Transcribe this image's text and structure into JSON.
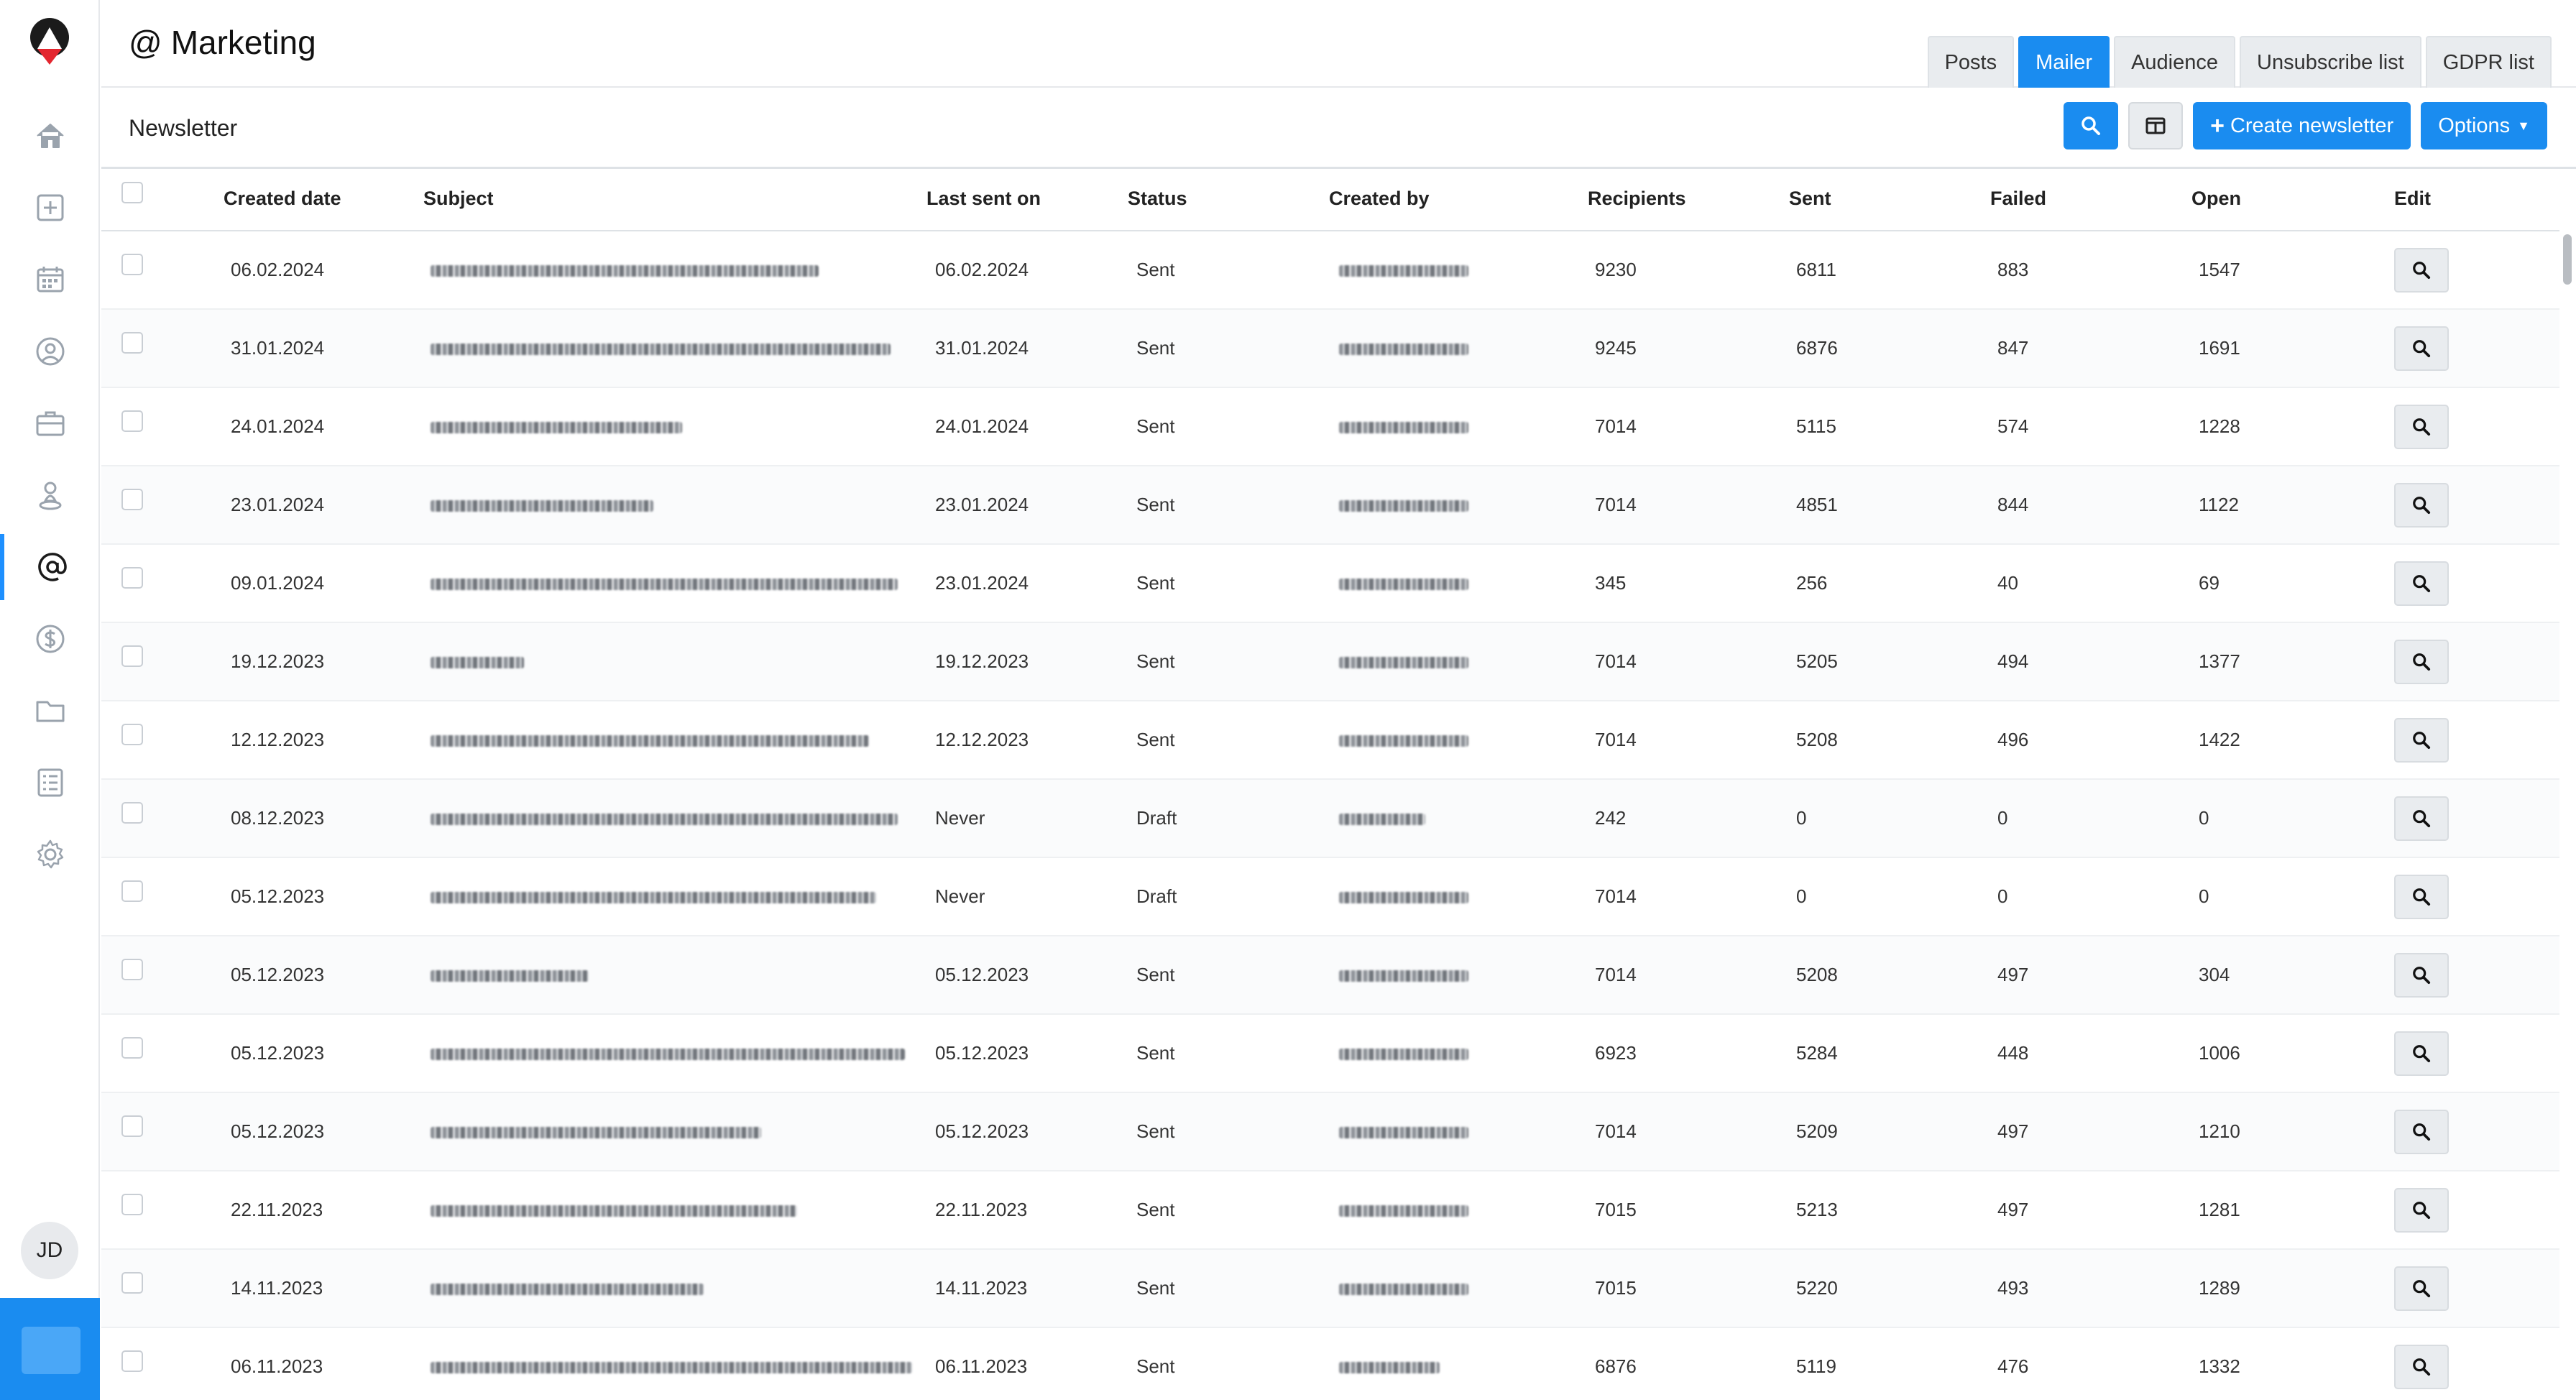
{
  "header": {
    "title_symbol": "@",
    "title": "Marketing",
    "tabs": [
      {
        "label": "Posts",
        "active": false
      },
      {
        "label": "Mailer",
        "active": true
      },
      {
        "label": "Audience",
        "active": false
      },
      {
        "label": "Unsubscribe list",
        "active": false
      },
      {
        "label": "GDPR list",
        "active": false
      }
    ]
  },
  "subheader": {
    "title": "Newsletter",
    "create_label": "Create newsletter",
    "options_label": "Options"
  },
  "sidebar": {
    "items": [
      "home-icon",
      "plus-square-icon",
      "calendar-icon",
      "user-circle-icon",
      "briefcase-icon",
      "person-pin-icon",
      "at-icon",
      "dollar-icon",
      "folder-icon",
      "checklist-icon",
      "gear-icon"
    ],
    "active_item": "at-icon",
    "avatar_initials": "JD"
  },
  "colors": {
    "accent": "#1a8cf0"
  },
  "table": {
    "columns": [
      "Created date",
      "Subject",
      "Last sent on",
      "Status",
      "Created by",
      "Recipients",
      "Sent",
      "Failed",
      "Open",
      "Edit"
    ],
    "rows": [
      {
        "created": "06.02.2024",
        "last_sent": "06.02.2024",
        "status": "Sent",
        "recipients": "9230",
        "sent": "6811",
        "failed": "883",
        "open": "1547"
      },
      {
        "created": "31.01.2024",
        "last_sent": "31.01.2024",
        "status": "Sent",
        "recipients": "9245",
        "sent": "6876",
        "failed": "847",
        "open": "1691"
      },
      {
        "created": "24.01.2024",
        "last_sent": "24.01.2024",
        "status": "Sent",
        "recipients": "7014",
        "sent": "5115",
        "failed": "574",
        "open": "1228"
      },
      {
        "created": "23.01.2024",
        "last_sent": "23.01.2024",
        "status": "Sent",
        "recipients": "7014",
        "sent": "4851",
        "failed": "844",
        "open": "1122"
      },
      {
        "created": "09.01.2024",
        "last_sent": "23.01.2024",
        "status": "Sent",
        "recipients": "345",
        "sent": "256",
        "failed": "40",
        "open": "69"
      },
      {
        "created": "19.12.2023",
        "last_sent": "19.12.2023",
        "status": "Sent",
        "recipients": "7014",
        "sent": "5205",
        "failed": "494",
        "open": "1377"
      },
      {
        "created": "12.12.2023",
        "last_sent": "12.12.2023",
        "status": "Sent",
        "recipients": "7014",
        "sent": "5208",
        "failed": "496",
        "open": "1422"
      },
      {
        "created": "08.12.2023",
        "last_sent": "Never",
        "status": "Draft",
        "recipients": "242",
        "sent": "0",
        "failed": "0",
        "open": "0"
      },
      {
        "created": "05.12.2023",
        "last_sent": "Never",
        "status": "Draft",
        "recipients": "7014",
        "sent": "0",
        "failed": "0",
        "open": "0"
      },
      {
        "created": "05.12.2023",
        "last_sent": "05.12.2023",
        "status": "Sent",
        "recipients": "7014",
        "sent": "5208",
        "failed": "497",
        "open": "304"
      },
      {
        "created": "05.12.2023",
        "last_sent": "05.12.2023",
        "status": "Sent",
        "recipients": "6923",
        "sent": "5284",
        "failed": "448",
        "open": "1006"
      },
      {
        "created": "05.12.2023",
        "last_sent": "05.12.2023",
        "status": "Sent",
        "recipients": "7014",
        "sent": "5209",
        "failed": "497",
        "open": "1210"
      },
      {
        "created": "22.11.2023",
        "last_sent": "22.11.2023",
        "status": "Sent",
        "recipients": "7015",
        "sent": "5213",
        "failed": "497",
        "open": "1281"
      },
      {
        "created": "14.11.2023",
        "last_sent": "14.11.2023",
        "status": "Sent",
        "recipients": "7015",
        "sent": "5220",
        "failed": "493",
        "open": "1289"
      },
      {
        "created": "06.11.2023",
        "last_sent": "06.11.2023",
        "status": "Sent",
        "recipients": "6876",
        "sent": "5119",
        "failed": "476",
        "open": "1332"
      }
    ]
  }
}
